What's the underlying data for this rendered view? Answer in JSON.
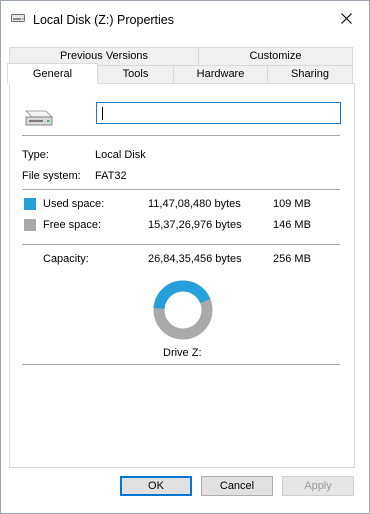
{
  "window": {
    "title": "Local Disk (Z:) Properties"
  },
  "tabs": {
    "row1": [
      "Previous Versions",
      "Customize"
    ],
    "row2": [
      "General",
      "Tools",
      "Hardware",
      "Sharing"
    ],
    "active": "General"
  },
  "general": {
    "name_value": "",
    "type_label": "Type:",
    "type_value": "Local Disk",
    "fs_label": "File system:",
    "fs_value": "FAT32",
    "used": {
      "label": "Used space:",
      "bytes": "11,47,08,480 bytes",
      "size": "109 MB",
      "color": "#26a0da"
    },
    "free": {
      "label": "Free space:",
      "bytes": "15,37,26,976 bytes",
      "size": "146 MB",
      "color": "#a9a9a9"
    },
    "capacity": {
      "label": "Capacity:",
      "bytes": "26,84,35,456 bytes",
      "size": "256 MB"
    },
    "drive_label": "Drive Z:",
    "used_fraction": 0.427
  },
  "buttons": {
    "ok": "OK",
    "cancel": "Cancel",
    "apply": "Apply"
  },
  "icons": {
    "title": "drive-icon",
    "close": "close-icon",
    "drive": "drive-icon"
  }
}
